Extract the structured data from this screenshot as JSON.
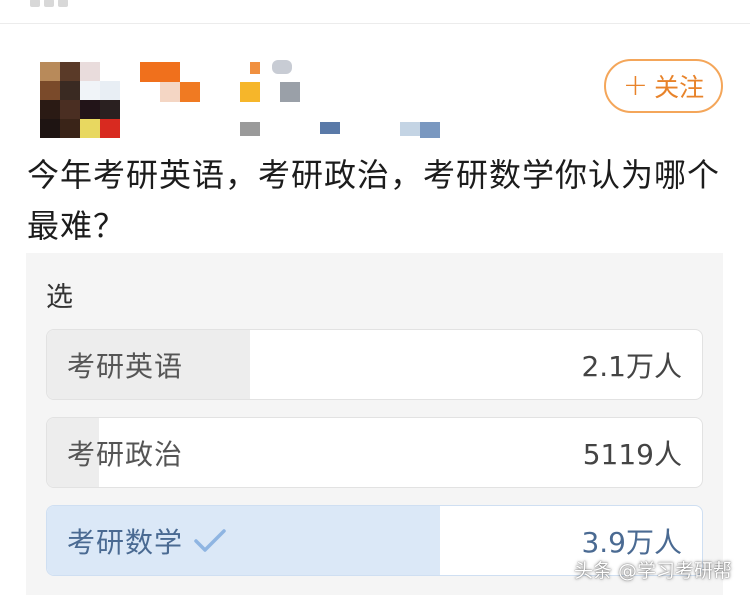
{
  "header": {
    "follow_label": "关注",
    "follow_plus": "+"
  },
  "question": {
    "text": "今年考研英语，考研政治，考研数学你认为哪个最难？"
  },
  "poll": {
    "type_label": "选",
    "options": [
      {
        "label": "考研英语",
        "count": "2.1万人",
        "share": 0.31,
        "selected": false
      },
      {
        "label": "考研政治",
        "count": "5119人",
        "share": 0.08,
        "selected": false
      },
      {
        "label": "考研数学",
        "count": "3.9万人",
        "share": 0.6,
        "selected": true
      }
    ]
  },
  "watermark": {
    "text": "头条 @学习考研帮"
  },
  "colors": {
    "accent_orange": "#e8832a",
    "selected_fill": "#dbe8f7",
    "selected_text": "#4a6a92",
    "bar_fill": "#ededed"
  },
  "icons": {
    "selected": "checkmark-icon",
    "follow": "plus-icon"
  }
}
